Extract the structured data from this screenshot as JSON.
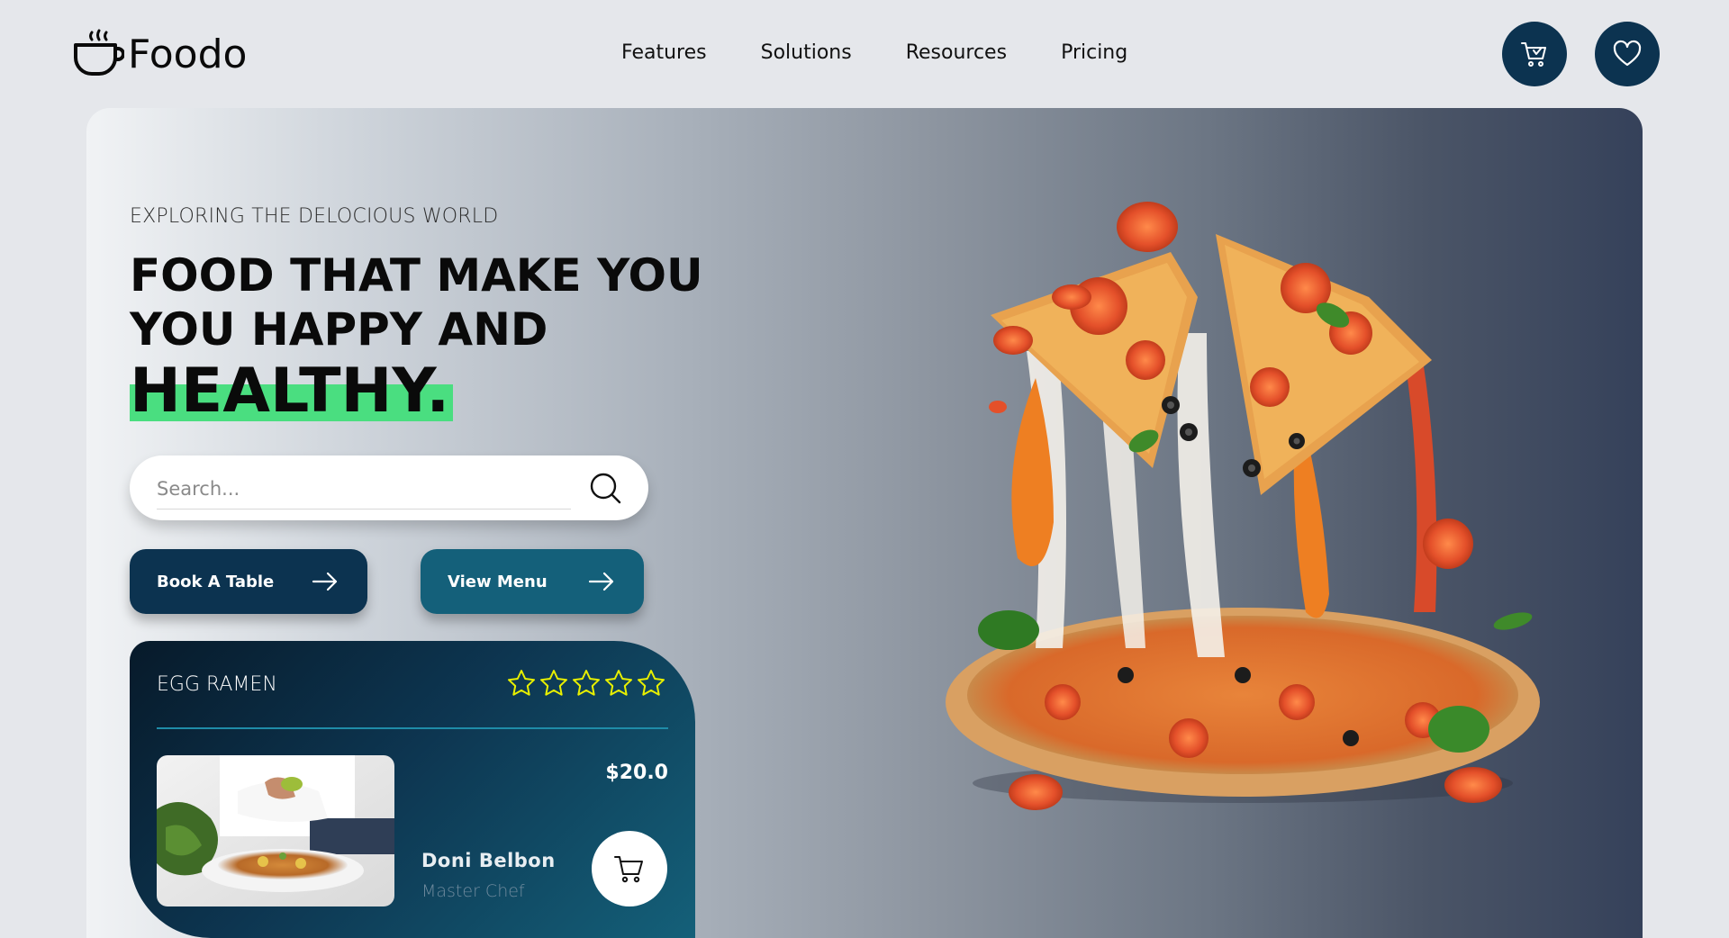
{
  "brand": {
    "name": "Foodo"
  },
  "nav": {
    "items": [
      {
        "label": "Features"
      },
      {
        "label": "Solutions"
      },
      {
        "label": "Resources"
      },
      {
        "label": "Pricing"
      }
    ]
  },
  "header_actions": [
    {
      "icon": "cart-icon"
    },
    {
      "icon": "heart-icon"
    }
  ],
  "hero": {
    "eyebrow": "EXPLORING THE DELOCIOUS WORLD",
    "headline_line1": "FOOD THAT MAKE YOU",
    "headline_line2": "YOU HAPPY AND",
    "headline_highlight": "HEALTHY.",
    "search": {
      "placeholder": "Search...",
      "value": ""
    },
    "buttons": {
      "book": "Book A Table",
      "menu": "View Menu"
    }
  },
  "dish_card": {
    "name": "EGG RAMEN",
    "rating": 5,
    "rating_max": 5,
    "price": "$20.0",
    "chef_name": "Doni Belbon",
    "chef_role": "Master Chef"
  },
  "colors": {
    "accent_dark": "#0c3350",
    "accent_teal": "#14607a",
    "highlight_green": "#4ade80",
    "star_yellow": "#e8f000"
  }
}
